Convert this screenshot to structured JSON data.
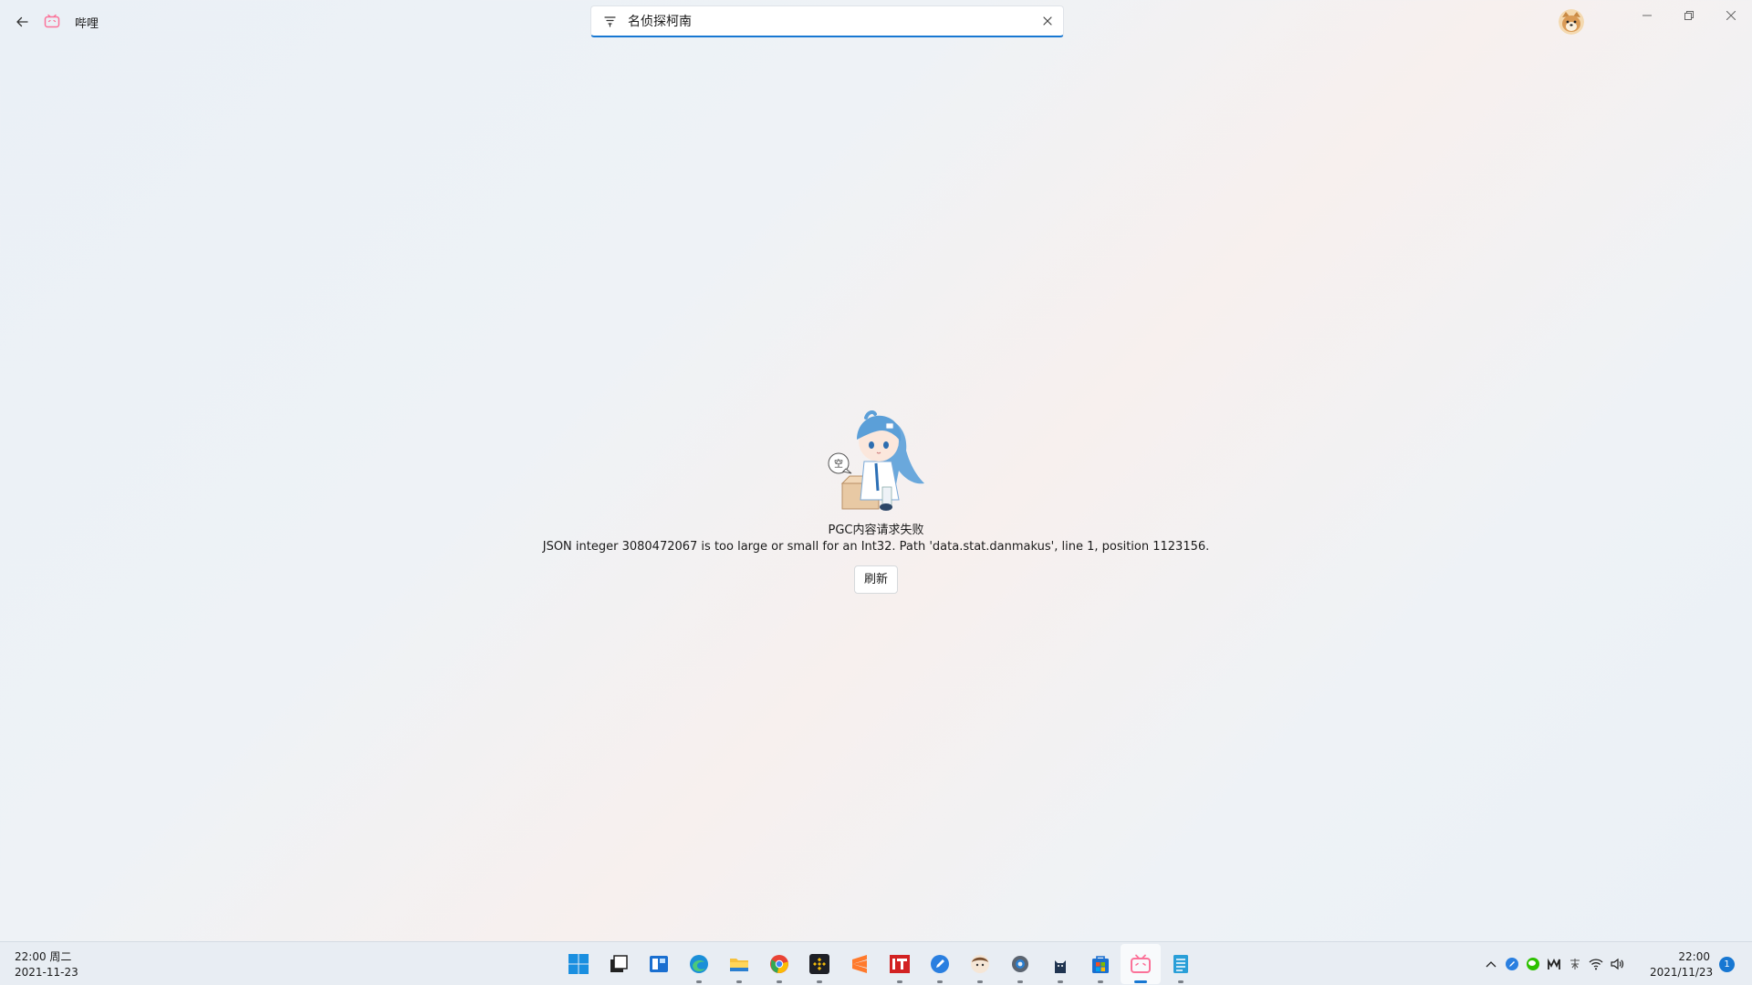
{
  "app": {
    "title": "哔哩",
    "accent": "#fb7299"
  },
  "search": {
    "value": "名侦探柯南",
    "placeholder": ""
  },
  "error": {
    "title": "PGC内容请求失败",
    "detail": "JSON integer 3080472067 is too large or small for an Int32. Path 'data.stat.danmakus', line 1, position 1123156.",
    "refresh_label": "刷新",
    "mascot_bubble": "空"
  },
  "taskbar": {
    "left_clock": {
      "time": "22:00 周二",
      "date": "2021-11-23"
    },
    "apps": [
      {
        "name": "start",
        "icon": "windows-logo-icon"
      },
      {
        "name": "task-view",
        "icon": "task-view-icon"
      },
      {
        "name": "widgets",
        "icon": "widgets-icon"
      },
      {
        "name": "edge",
        "icon": "edge-icon"
      },
      {
        "name": "file-explorer",
        "icon": "folder-icon"
      },
      {
        "name": "chrome",
        "icon": "chrome-icon"
      },
      {
        "name": "binance",
        "icon": "binance-icon"
      },
      {
        "name": "sublime",
        "icon": "sublime-icon"
      },
      {
        "name": "ithome",
        "icon": "ithome-icon"
      },
      {
        "name": "edit-app",
        "icon": "pen-icon"
      },
      {
        "name": "character-app",
        "icon": "anime-icon"
      },
      {
        "name": "settings",
        "icon": "gear-icon"
      },
      {
        "name": "cat-app",
        "icon": "cat-icon"
      },
      {
        "name": "store",
        "icon": "store-icon"
      },
      {
        "name": "bilibili",
        "icon": "bilibili-tv-icon"
      },
      {
        "name": "notepad",
        "icon": "notepad-icon"
      }
    ],
    "active_app": "bilibili",
    "tray": {
      "time": "22:00",
      "date": "2021/11/23",
      "notifications": "1"
    }
  }
}
